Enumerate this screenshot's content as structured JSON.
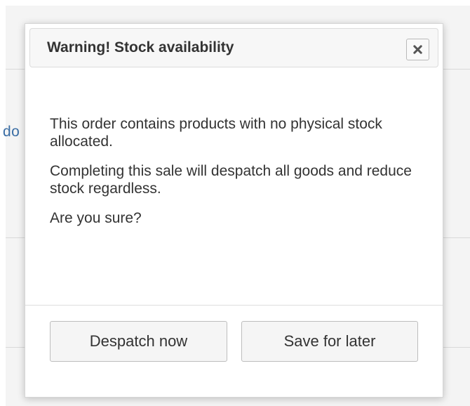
{
  "background": {
    "partial_text": "do"
  },
  "dialog": {
    "title": "Warning! Stock availability",
    "close_icon": "close-icon",
    "messages": [
      "This order contains products with no physical stock allocated.",
      "Completing this sale will despatch all goods and reduce stock regardless.",
      "Are you sure?"
    ],
    "buttons": {
      "despatch_now": "Despatch now",
      "save_for_later": "Save for later"
    }
  },
  "colors": {
    "title_text": "#333333",
    "background_link": "#3b6ea5"
  }
}
